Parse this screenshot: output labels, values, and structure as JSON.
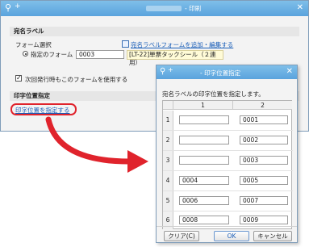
{
  "back_window": {
    "title": "- 印刷",
    "section1_heading": "宛名ラベル",
    "form_select_label": "フォーム選択",
    "add_edit_link": "宛名ラベルフォームを追加・編集する",
    "radio_label": "指定のフォーム",
    "form_code": "0003",
    "form_name": "[LT-22]単票タックシール（２連用）",
    "checkbox_label": "次回発行時もこのフォームを使用する",
    "section2_heading": "印字位置指定",
    "position_link": "印字位置を指定する"
  },
  "dialog": {
    "title": "- 印字位置指定",
    "message": "宛名ラベルの印字位置を指定します。",
    "col_headers": [
      "1",
      "2"
    ],
    "rows": [
      {
        "label": "1",
        "col1": "",
        "col2": "0001"
      },
      {
        "label": "2",
        "col1": "",
        "col2": "0002"
      },
      {
        "label": "3",
        "col1": "",
        "col2": "0003"
      },
      {
        "label": "4",
        "col1": "0004",
        "col2": "0005"
      },
      {
        "label": "5",
        "col1": "0006",
        "col2": "0007"
      },
      {
        "label": "6",
        "col1": "0008",
        "col2": "0009"
      }
    ],
    "buttons": {
      "clear": "クリア(C)",
      "ok": "OK",
      "cancel": "キャンセル"
    }
  },
  "colors": {
    "titlebar": "#5aa3dd",
    "highlight": "#e0232c",
    "link": "#1b5fb9"
  }
}
